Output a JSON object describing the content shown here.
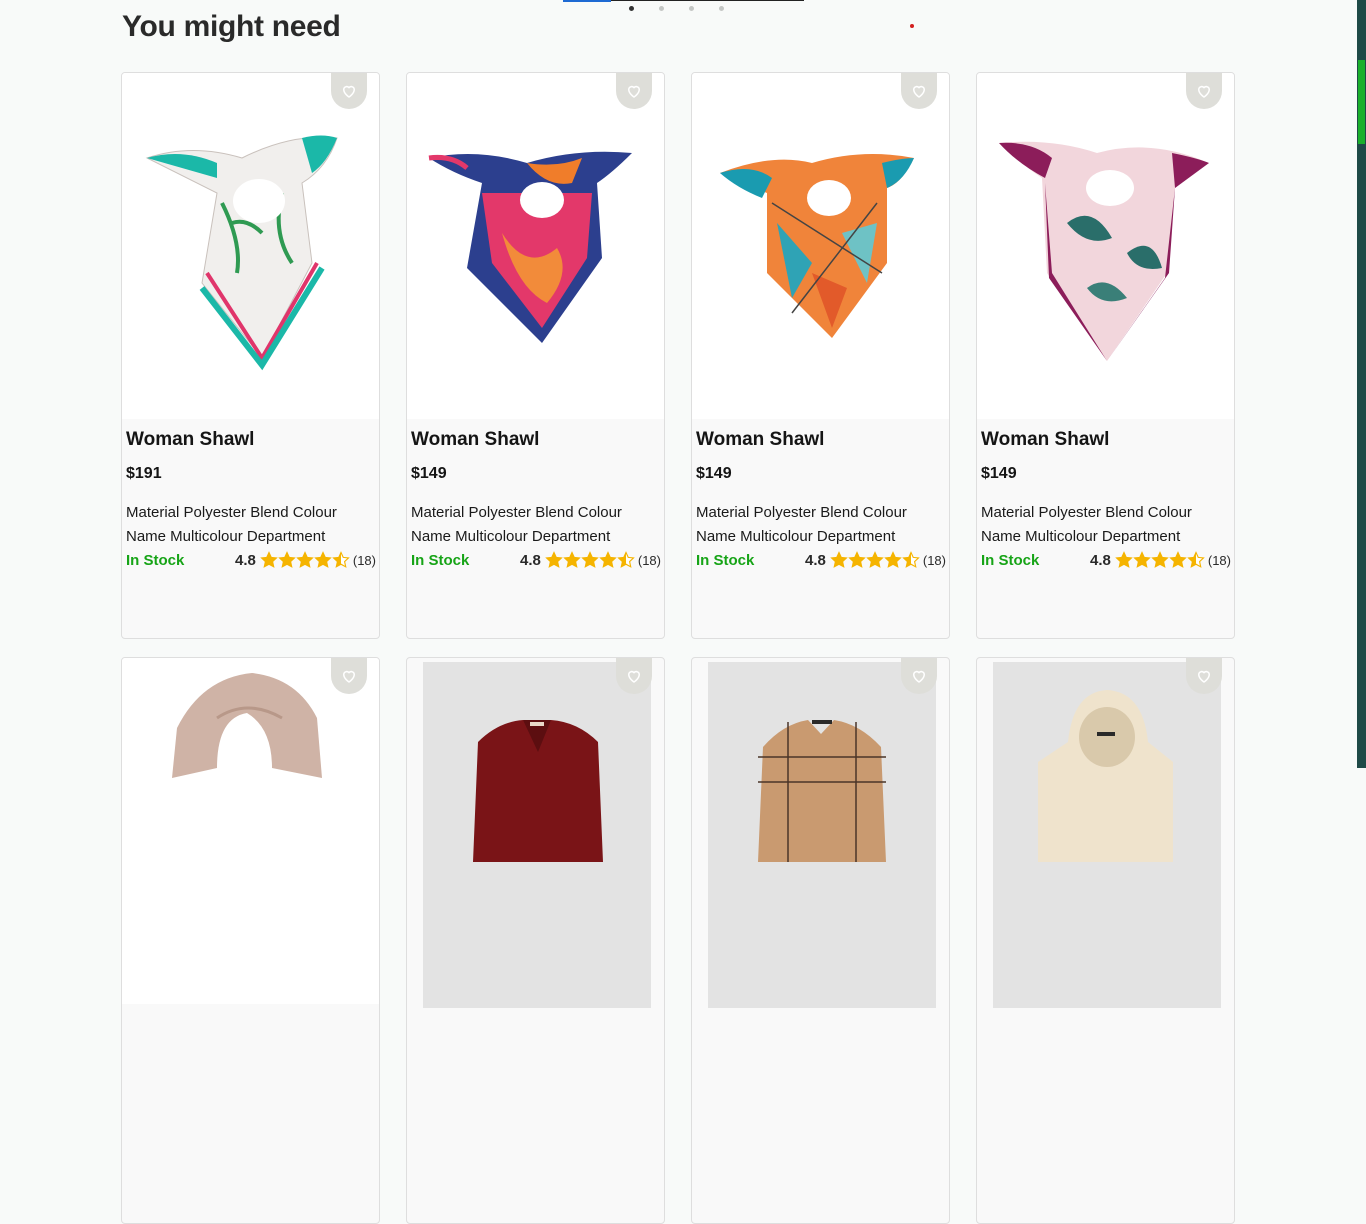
{
  "section": {
    "title": "You might need"
  },
  "carousel": {
    "dot_count": 4,
    "active_index": 0
  },
  "colors": {
    "accent_green": "#17a417",
    "star": "#f5b400",
    "scrollbar_thumb": "#1bb02c"
  },
  "products": [
    {
      "name": "Woman Shawl",
      "price": "$191",
      "description": "Material Polyester Blend Colour Name Multicolour Department",
      "stock": "In Stock",
      "rating": "4.8",
      "rating_value": 4.5,
      "reviews": "(18)",
      "favorite_icon": "heart-outline-icon",
      "image": "scarf-white-teal-floral"
    },
    {
      "name": "Woman Shawl",
      "price": "$149",
      "description": "Material Polyester Blend Colour Name Multicolour Department",
      "stock": "In Stock",
      "rating": "4.8",
      "rating_value": 4.5,
      "reviews": "(18)",
      "favorite_icon": "heart-outline-icon",
      "image": "scarf-navy-pink-floral"
    },
    {
      "name": "Woman Shawl",
      "price": "$149",
      "description": "Material Polyester Blend Colour Name Multicolour Department",
      "stock": "In Stock",
      "rating": "4.8",
      "rating_value": 4.5,
      "reviews": "(18)",
      "favorite_icon": "heart-outline-icon",
      "image": "scarf-orange-teal-geometric"
    },
    {
      "name": "Woman Shawl",
      "price": "$149",
      "description": "Material Polyester Blend Colour Name Multicolour Department",
      "stock": "In Stock",
      "rating": "4.8",
      "rating_value": 4.5,
      "reviews": "(18)",
      "favorite_icon": "heart-outline-icon",
      "image": "scarf-plum-pink-leaf"
    }
  ],
  "next_row": [
    {
      "image": "beige-scarf",
      "favorite_icon": "heart-outline-icon"
    },
    {
      "image": "burgundy-shirt",
      "favorite_icon": "heart-outline-icon"
    },
    {
      "image": "tan-plaid-shirt",
      "favorite_icon": "heart-outline-icon"
    },
    {
      "image": "cream-hoodie",
      "favorite_icon": "heart-outline-icon"
    }
  ]
}
